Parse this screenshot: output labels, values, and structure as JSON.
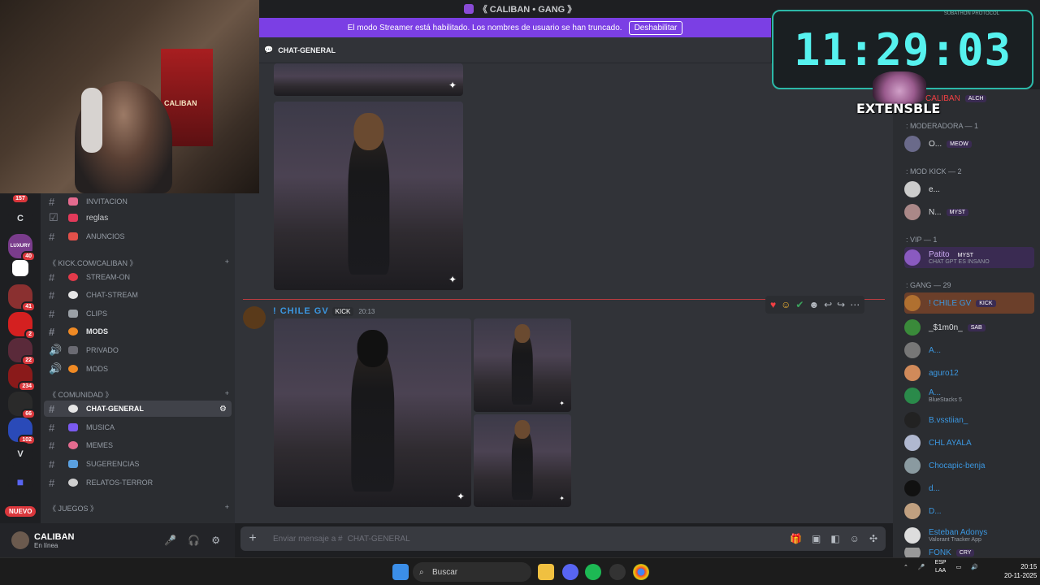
{
  "window": {
    "title": "《 CALIBAN • GANG 》"
  },
  "banner": {
    "text": "El modo Streamer está habilitado. Los nombres de usuario se han truncado.",
    "button": "Deshabilitar"
  },
  "timer": {
    "value": "11:29:03",
    "label": "SUBATHON PROTOCOL",
    "mascot_text": "EXTENSBLE"
  },
  "webcam": {
    "poster_text": "CALIBAN"
  },
  "rail": {
    "top_badge": "157",
    "servers": [
      {
        "label": "C",
        "badge": ""
      },
      {
        "label": "LUXURY",
        "badge": "40"
      },
      {
        "label": "",
        "badge": ""
      },
      {
        "label": "",
        "badge": "41"
      },
      {
        "label": "",
        "badge": "2"
      },
      {
        "label": "",
        "badge": "22"
      },
      {
        "label": "",
        "badge": "234"
      },
      {
        "label": "",
        "badge": "66"
      },
      {
        "label": "",
        "badge": "102"
      },
      {
        "label": "V",
        "badge": ""
      }
    ],
    "nuevo": "NUEVO"
  },
  "sidebar": {
    "channels_top": [
      {
        "name": "INVITACION"
      },
      {
        "name": "reglas"
      },
      {
        "name": "ANUNCIOS"
      }
    ],
    "cat1": "《 KICK.COM/CALIBAN 》",
    "channels_kick": [
      {
        "name": "STREAM-ON"
      },
      {
        "name": "CHAT-STREAM"
      },
      {
        "name": "CLIPS"
      },
      {
        "name": "MODS"
      },
      {
        "name": "PRIVADO"
      },
      {
        "name": "MODS"
      }
    ],
    "cat2": "《 COMUNIDAD 》",
    "channels_comunidad": [
      {
        "name": "CHAT-GENERAL"
      },
      {
        "name": "MUSICA"
      },
      {
        "name": "MEMES"
      },
      {
        "name": "SUGERENCIAS"
      },
      {
        "name": "RELATOS-TERROR"
      }
    ],
    "cat3": "《 JUEGOS 》"
  },
  "user": {
    "name": "CALIBAN",
    "status": "En línea"
  },
  "chat": {
    "channel": "CHAT-GENERAL",
    "message": {
      "author": "! CHILE GV",
      "badge": "KICK",
      "time": "20:13"
    },
    "input_placeholder": "Enviar mensaje a #",
    "input_channel": "CHAT-GENERAL"
  },
  "members": {
    "top_name": "CALIBAN",
    "top_tag": "ALCH",
    "groups": [
      {
        "title": ": MODERADORA — 1",
        "members": [
          {
            "name": "O...",
            "tag": "MEOW",
            "sub": ""
          }
        ]
      },
      {
        "title": ": MOD KICK — 2",
        "members": [
          {
            "name": "e...",
            "tag": "",
            "sub": ""
          },
          {
            "name": "N...",
            "tag": "MYST",
            "sub": ""
          }
        ]
      },
      {
        "title": ": VIP — 1",
        "members": [
          {
            "name": "Patito",
            "tag": "MYST",
            "sub": "CHAT GPT ES INSANO"
          }
        ]
      },
      {
        "title": ": GANG — 29",
        "members": [
          {
            "name": "! CHILE GV",
            "tag": "KICK",
            "sub": ""
          },
          {
            "name": "_$1m0n_",
            "tag": "SAB",
            "sub": ""
          },
          {
            "name": "A...",
            "tag": "",
            "sub": ""
          },
          {
            "name": "aguro12",
            "tag": "",
            "sub": ""
          },
          {
            "name": "A...",
            "tag": "",
            "sub": "BlueStacks 5"
          },
          {
            "name": "B.vsstiian_",
            "tag": "",
            "sub": ""
          },
          {
            "name": "CHL AYALA",
            "tag": "",
            "sub": ""
          },
          {
            "name": "Chocapic-benja",
            "tag": "",
            "sub": ""
          },
          {
            "name": "d...",
            "tag": "",
            "sub": ""
          },
          {
            "name": "D...",
            "tag": "",
            "sub": ""
          },
          {
            "name": "Esteban Adonys",
            "tag": "",
            "sub": "Valorant Tracker App"
          },
          {
            "name": "FONK",
            "tag": "CRY",
            "sub": ""
          }
        ]
      }
    ]
  },
  "taskbar": {
    "search": "Buscar",
    "lang": "ESP",
    "lang2": "LAA",
    "time": "20:15",
    "date": "20-11-2025"
  }
}
